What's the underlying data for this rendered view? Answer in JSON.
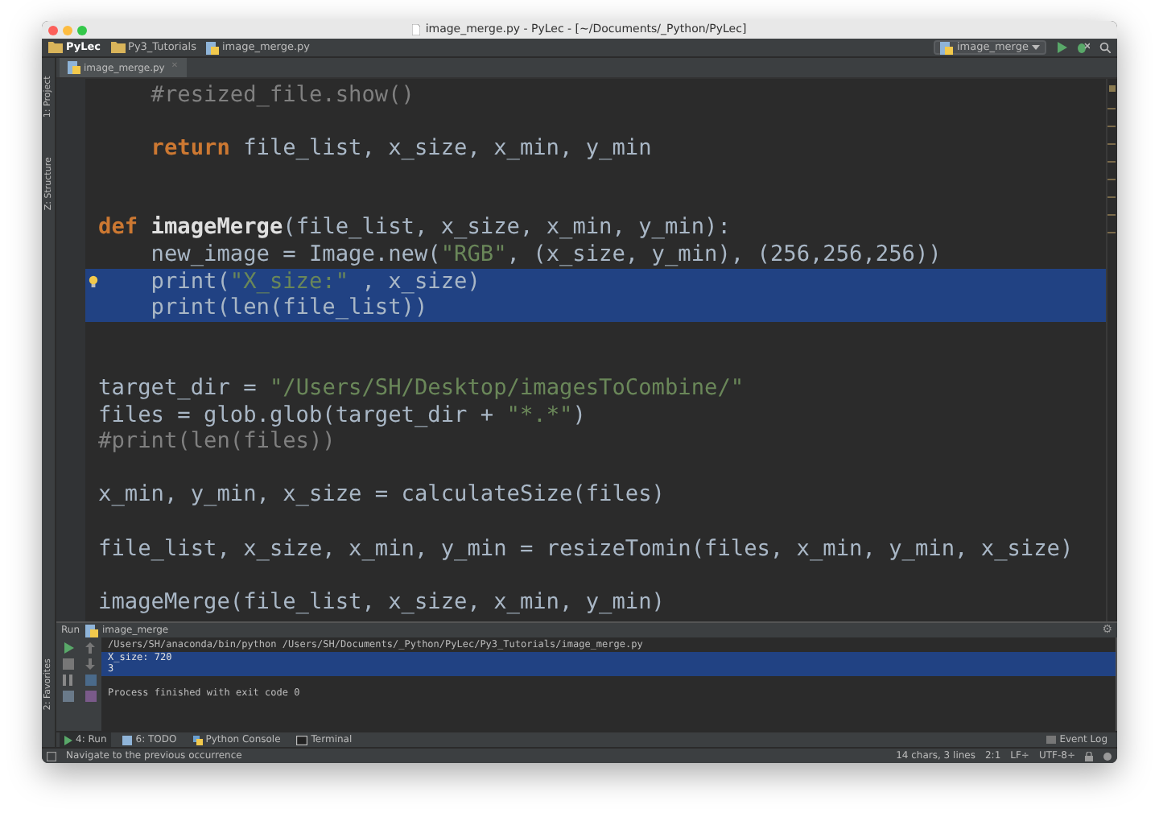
{
  "window": {
    "title": "image_merge.py - PyLec - [~/Documents/_Python/PyLec]"
  },
  "navbar": {
    "breadcrumbs": [
      "PyLec",
      "Py3_Tutorials",
      "image_merge.py"
    ],
    "run_config": "image_merge"
  },
  "editor_tab": {
    "label": "image_merge.py",
    "close": "✕"
  },
  "left_tools": [
    "1: Project",
    "Z: Structure"
  ],
  "editor": {
    "lines": [
      {
        "selected": false,
        "bulb": false,
        "tokens": [
          {
            "kind": "comment",
            "text": "    #resized_file.show()"
          }
        ]
      },
      {
        "kind": "blank"
      },
      {
        "selected": false,
        "bulb": false,
        "tokens": [
          {
            "kind": "keyword",
            "text": "    return"
          },
          {
            "kind": "plain",
            "text": " file_list, x_size, x_min, y_min"
          }
        ]
      },
      {
        "kind": "blank"
      },
      {
        "kind": "blank"
      },
      {
        "selected": false,
        "bulb": false,
        "tokens": [
          {
            "kind": "keyword",
            "text": "def"
          },
          {
            "kind": "function",
            "text": " imageMerge"
          },
          {
            "kind": "plain",
            "text": "(file_list, x_size, x_min, y_min):"
          }
        ]
      },
      {
        "selected": false,
        "bulb": false,
        "tokens": [
          {
            "kind": "plain",
            "text": "    new_image = Image.new("
          },
          {
            "kind": "string",
            "text": "\"RGB\""
          },
          {
            "kind": "plain",
            "text": ", (x_size, y_min), (256,256,256))"
          }
        ]
      },
      {
        "selected": true,
        "bulb": true,
        "tokens": [
          {
            "kind": "plain",
            "text": "    print("
          },
          {
            "kind": "string",
            "text": "\"X_size:\""
          },
          {
            "kind": "plain",
            "text": " , x_size)"
          }
        ]
      },
      {
        "selected": true,
        "bulb": false,
        "tokens": [
          {
            "kind": "plain",
            "text": "    print(len(file_list))"
          }
        ]
      },
      {
        "kind": "blank"
      },
      {
        "kind": "blank"
      },
      {
        "selected": false,
        "bulb": false,
        "tokens": [
          {
            "kind": "plain",
            "text": "target_dir = "
          },
          {
            "kind": "string",
            "text": "\"/Users/SH/Desktop/imagesToCombine/\""
          }
        ]
      },
      {
        "selected": false,
        "bulb": false,
        "tokens": [
          {
            "kind": "plain",
            "text": "files = glob.glob(target_dir + "
          },
          {
            "kind": "string",
            "text": "\"*.*\""
          },
          {
            "kind": "plain",
            "text": ")"
          }
        ]
      },
      {
        "selected": false,
        "bulb": false,
        "tokens": [
          {
            "kind": "comment",
            "text": "#print(len(files))"
          }
        ]
      },
      {
        "kind": "blank"
      },
      {
        "selected": false,
        "bulb": false,
        "tokens": [
          {
            "kind": "plain",
            "text": "x_min, y_min, x_size = calculateSize(files)"
          }
        ]
      },
      {
        "kind": "blank"
      },
      {
        "selected": false,
        "bulb": false,
        "tokens": [
          {
            "kind": "plain",
            "text": "file_list, x_size, x_min, y_min = resizeTomin(files, x_min, y_min, x_size)"
          }
        ]
      },
      {
        "kind": "blank"
      },
      {
        "selected": false,
        "bulb": false,
        "tokens": [
          {
            "kind": "plain",
            "text": "imageMerge(file_list, x_size, x_min, y_min)"
          }
        ]
      }
    ]
  },
  "run_panel": {
    "title": "Run",
    "config": "image_merge",
    "settings": "⚙",
    "favorites": "2: Favorites",
    "output": [
      {
        "kind": "command",
        "text": "/Users/SH/anaconda/bin/python /Users/SH/Documents/_Python/PyLec/Py3_Tutorials/image_merge.py",
        "selected": false
      },
      {
        "kind": "output",
        "text": "X_size: 720",
        "selected": true
      },
      {
        "kind": "output",
        "text": "3",
        "selected": true
      },
      {
        "kind": "exit",
        "text": "Process finished with exit code 0",
        "selected": false
      }
    ]
  },
  "tool_windows": [
    {
      "label": "4: Run",
      "kind": "run",
      "selected": true
    },
    {
      "label": "6: TODO",
      "kind": "todo",
      "selected": false
    },
    {
      "label": "Python Console",
      "kind": "console",
      "selected": false
    },
    {
      "label": "Terminal",
      "kind": "terminal",
      "selected": false
    }
  ],
  "event_log": "Event Log",
  "status_bar": {
    "message": "Navigate to the previous occurrence",
    "items": [
      "14 chars, 3 lines",
      "2:1",
      "LF÷",
      "UTF-8÷"
    ]
  }
}
